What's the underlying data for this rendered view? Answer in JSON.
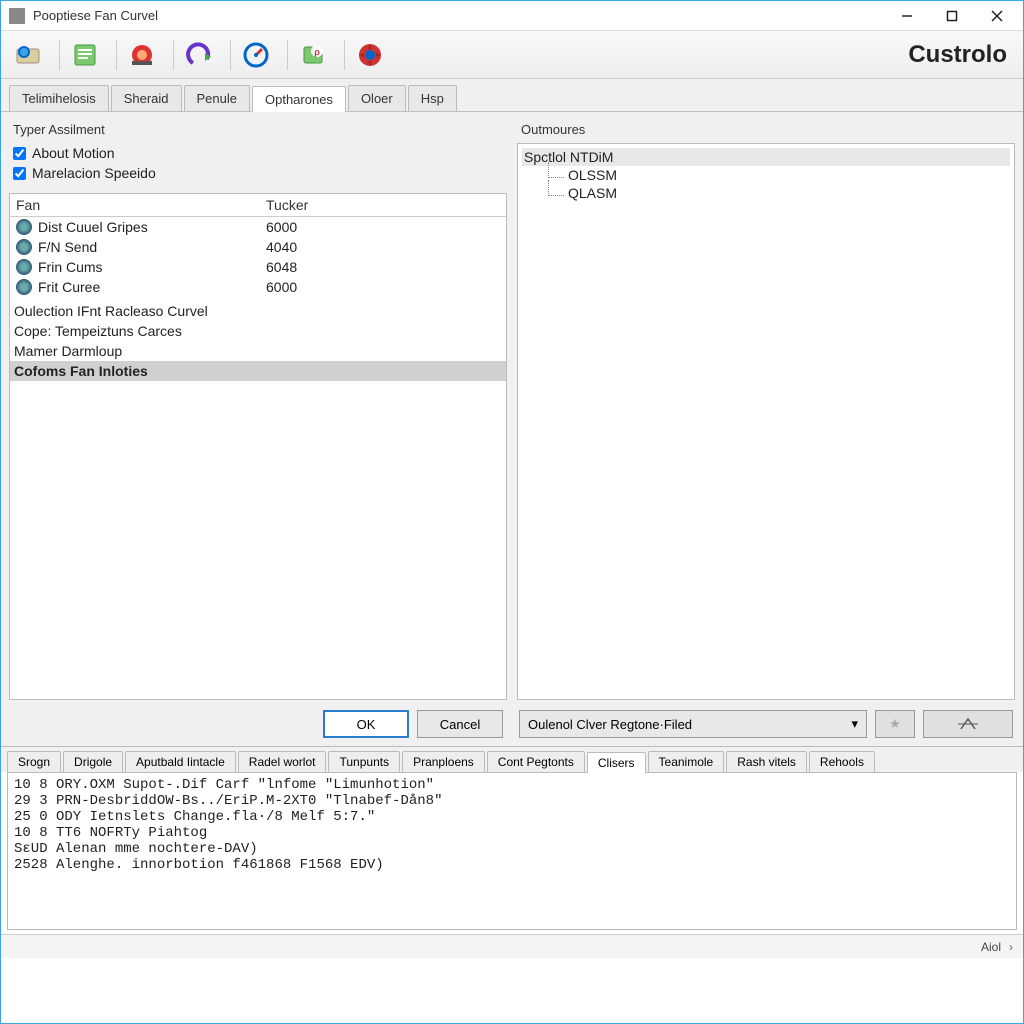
{
  "window": {
    "title": "Pooptiese Fan Curvel"
  },
  "toolbar": {
    "brand": "Custrolo"
  },
  "main_tabs": [
    "Telimihelosis",
    "Sheraid",
    "Penule",
    "Optharones",
    "Oloer",
    "Hsp"
  ],
  "main_tabs_active_index": 3,
  "left_panel": {
    "title": "Typer Assilment",
    "checks": [
      {
        "label": "About Motion",
        "checked": true
      },
      {
        "label": "Marelacion Speeido",
        "checked": true
      }
    ],
    "col_headers": [
      "Fan",
      "Tucker"
    ],
    "fan_rows": [
      {
        "name": "Dist Cuuel Gripes",
        "value": "6000"
      },
      {
        "name": "F/N Send",
        "value": "4040"
      },
      {
        "name": "Frin Cums",
        "value": "6048"
      },
      {
        "name": "Frit Curee",
        "value": "6000"
      }
    ],
    "plain_rows": [
      "Oulection IFnt Racleaso Curvel",
      "Cope: Tempeiztuns Carces",
      "Mamer Darmloup",
      "Cofoms Fan Inloties"
    ],
    "plain_selected_index": 3,
    "ok": "OK",
    "cancel": "Cancel"
  },
  "right_panel": {
    "title": "Outmoures",
    "root": "Spctlol NTDiM",
    "children": [
      "OLSSM",
      "QLASМ"
    ],
    "combo": "Oulenol Clver Regtone·Filed"
  },
  "lower_tabs": [
    "Srogn",
    "Drigole",
    "Aputbald Iintacle",
    "Radel worlot",
    "Tunpunts",
    "Pranploens",
    "Cont Pegtonts",
    "Clisers",
    "Teanimole",
    "Rash vitels",
    "Rehools"
  ],
  "lower_tabs_active_index": 7,
  "log_lines": [
    "10 8 ORY.OXM Supot-.Dif Carf \"lnfome \"Limunhotion\"",
    "29 3 PRN-DesbriddOW-Bs../EriP.M-2XT0 \"Tlnabef-Dån8\"",
    "25 0 ODY Ietnslets Change.fla·/8 Melf 5:7.\"",
    "10 8 TT6 NOFRTy Piahtog",
    "SɛUD Alenan mme nochtere-DAV)",
    "2528 Alenghe. innorbotion f461868 F1568 EDV)"
  ],
  "status": {
    "text": "Aiol"
  }
}
